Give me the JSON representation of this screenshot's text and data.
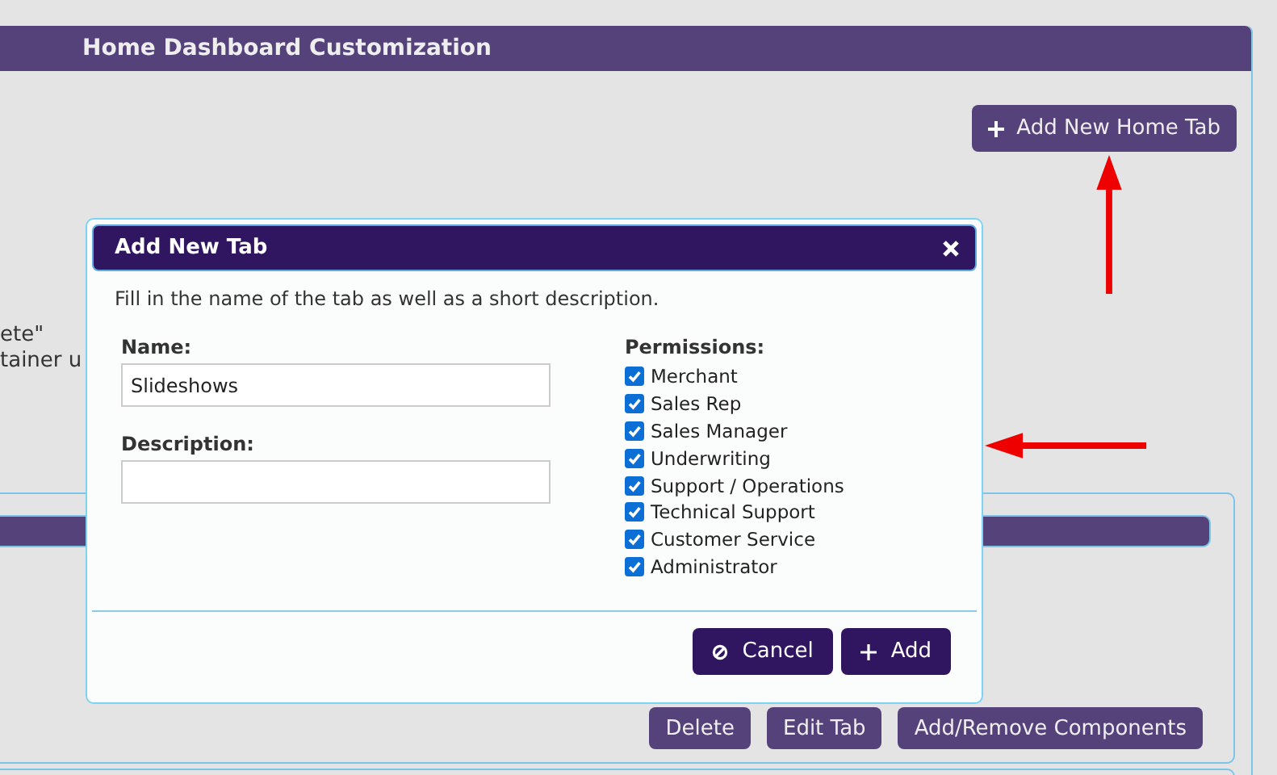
{
  "panel": {
    "title": "Home Dashboard Customization",
    "add_button": "Add New Home Tab",
    "notes": [
      "ete\"",
      "tainer u"
    ],
    "tab_actions": [
      "Delete",
      "Edit Tab",
      "Add/Remove Components"
    ]
  },
  "dialog": {
    "title": "Add New Tab",
    "intro": "Fill in the name of the tab as well as a short description.",
    "name_label": "Name:",
    "name_value": "Slideshows",
    "description_label": "Description:",
    "permissions_label": "Permissions:",
    "permissions": [
      {
        "label": "Merchant",
        "checked": true
      },
      {
        "label": "Sales Rep",
        "checked": true
      },
      {
        "label": "Sales Manager",
        "checked": true
      },
      {
        "label": "Underwriting",
        "checked": true
      },
      {
        "label": "Support / Operations",
        "checked": true
      },
      {
        "label": "Technical Support",
        "checked": true
      },
      {
        "label": "Customer Service",
        "checked": true
      },
      {
        "label": "Administrator",
        "checked": true
      }
    ],
    "buttons": [
      {
        "label": "Cancel",
        "kind": "cancel"
      },
      {
        "label": "Add",
        "kind": "add"
      }
    ]
  }
}
